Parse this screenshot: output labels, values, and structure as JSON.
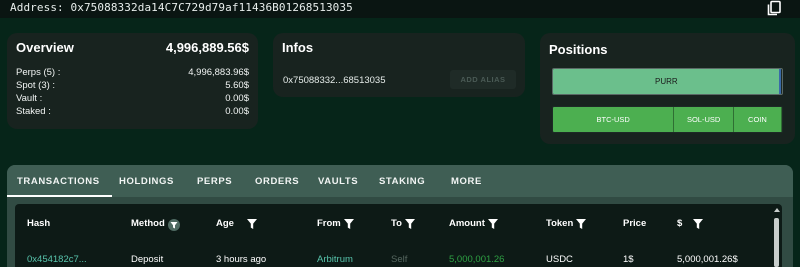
{
  "address": {
    "text": "Address: 0x75088332da14C7C729d79af11436B01268513035"
  },
  "overview": {
    "title": "Overview",
    "total": "4,996,889.56$",
    "rows": [
      {
        "label": "Perps (5) :",
        "value": "4,996,883.96$"
      },
      {
        "label": "Spot (3) :",
        "value": "5.60$"
      },
      {
        "label": "Vault :",
        "value": "0.00$"
      },
      {
        "label": "Staked :",
        "value": "0.00$"
      }
    ]
  },
  "infos": {
    "title": "Infos",
    "address_short": "0x75088332...68513035",
    "alias_button": "ADD ALIAS"
  },
  "positions": {
    "title": "Positions",
    "purr": {
      "label": "PURR",
      "fill_fraction": 0.99
    },
    "segments": [
      {
        "label": "BTC-USD",
        "share": 0.53
      },
      {
        "label": "SOL-USD",
        "share": 0.26
      },
      {
        "label": "COIN",
        "share": 0.21
      }
    ],
    "accent_color": "#4caf50",
    "purr_color": "#6bbf8c"
  },
  "tabs": [
    "TRANSACTIONS",
    "HOLDINGS",
    "PERPS",
    "ORDERS",
    "VAULTS",
    "STAKING",
    "MORE"
  ],
  "active_tab": "TRANSACTIONS",
  "table": {
    "headers": [
      "Hash",
      "Method",
      "Age",
      "From",
      "To",
      "Amount",
      "Token",
      "Price",
      "$"
    ],
    "rows": [
      {
        "hash": "0x454182c7...",
        "method": "Deposit",
        "age": "3 hours ago",
        "from": "Arbitrum",
        "to": "Self",
        "amount": "5,000,001.26",
        "token": "USDC",
        "price": "1$",
        "usd": "5,000,001.26$"
      }
    ]
  },
  "icons": {
    "copy": "copy-icon",
    "filter": "filter-icon"
  },
  "colors": {
    "background": "#062519",
    "card": "#18231f",
    "link": "#58c4ac",
    "amount": "#2ea043"
  }
}
